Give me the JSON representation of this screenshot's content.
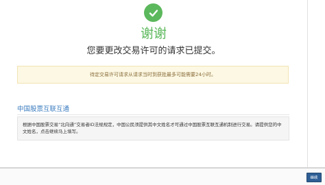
{
  "confirmation": {
    "title": "谢谢",
    "subtitle": "您要更改交易许可的请求已提交。"
  },
  "notice": {
    "text": "待定交易许可请求从请求当时到获批最多可能需要24小时。"
  },
  "section": {
    "heading": "中国股票互联互通",
    "body": "根据中国股票交易“北向通”交易者ID法规规定，中国公民须提供其中文姓名才可通过中国股票互联互通机制进行交易。请提供您的中文姓名，点击继续马上填写。"
  },
  "footer": {
    "continue_label": "继续"
  },
  "colors": {
    "success": "#5cb85c",
    "notice_bg": "#fcf8e3",
    "link": "#3a7bbf",
    "button": "#2e5e95"
  },
  "icons": {
    "status": "check-circle-icon"
  }
}
